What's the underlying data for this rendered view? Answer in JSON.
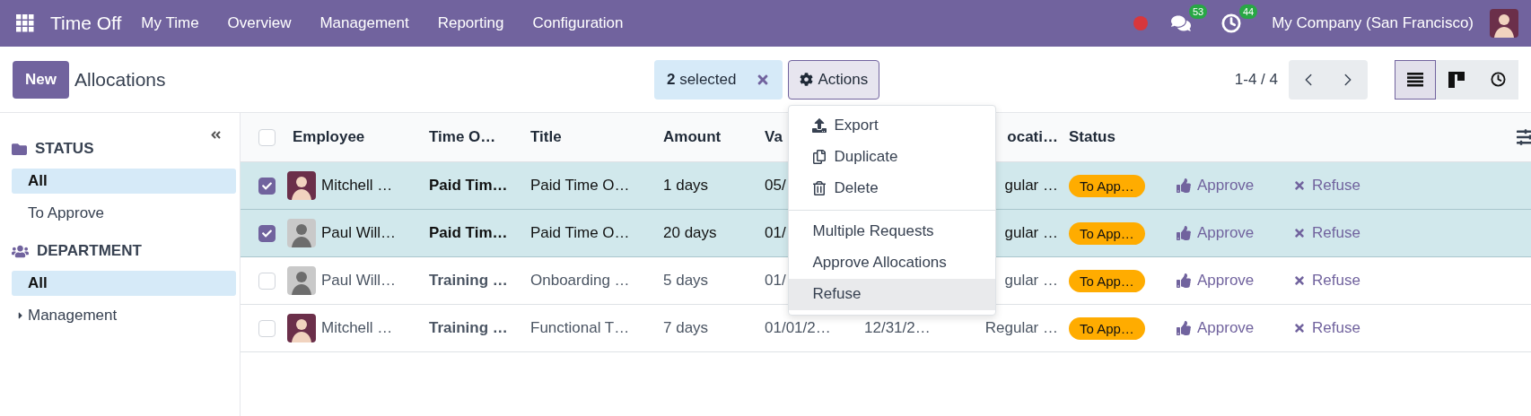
{
  "navbar": {
    "app_title": "Time Off",
    "menu": [
      "My Time",
      "Overview",
      "Management",
      "Reporting",
      "Configuration"
    ],
    "messages_count": "53",
    "activities_count": "44",
    "company": "My Company (San Francisco)"
  },
  "control_panel": {
    "new_button": "New",
    "breadcrumb": "Allocations",
    "selection": "**2** selected",
    "actions_button": "Actions",
    "pager": "1-4 / 4",
    "views": [
      {
        "kind": "list",
        "selected": true
      },
      {
        "kind": "kanban",
        "selected": false
      },
      {
        "kind": "activity",
        "selected": false
      }
    ]
  },
  "actions_menu": {
    "groups": [
      [
        {
          "label": "Export",
          "kind": "export",
          "highlighted": false
        },
        {
          "label": "Duplicate",
          "kind": "duplicate",
          "highlighted": false
        },
        {
          "label": "Delete",
          "kind": "delete",
          "highlighted": false
        }
      ],
      [
        {
          "label": "Multiple Requests",
          "kind": "plain",
          "highlighted": false
        },
        {
          "label": "Approve Allocations",
          "kind": "plain",
          "highlighted": false
        },
        {
          "label": "Refuse",
          "kind": "plain",
          "highlighted": true
        }
      ]
    ]
  },
  "sidebar": {
    "sections": [
      {
        "title": "STATUS",
        "kind": "folder",
        "items": [
          {
            "label": "All",
            "selected": true
          },
          {
            "label": "To Approve",
            "selected": false
          }
        ]
      },
      {
        "title": "DEPARTMENT",
        "kind": "users",
        "items": [
          {
            "label": "All",
            "selected": true
          },
          {
            "label": "Management",
            "selected": false,
            "expanded": false
          }
        ]
      }
    ]
  },
  "table": {
    "columns": {
      "employee": "Employee",
      "column_2": "Time O…",
      "title": "Title",
      "amount": "Amount",
      "column_5": "Va",
      "column_7": "ocati…",
      "status": "Status"
    },
    "all_checked": false,
    "rows": [
      {
        "selected": true,
        "kind": "cartoon",
        "employee": "Mitchell …",
        "column_2": "Paid Tim…",
        "title": "Paid Time O…",
        "amount": "1 days",
        "column_5": "05/",
        "column_7": "gular …",
        "status": "To App…",
        "approve": "Approve",
        "refuse": "Refuse"
      },
      {
        "selected": true,
        "kind": "photo",
        "employee": "Paul Will…",
        "column_2": "Paid Tim…",
        "title": "Paid Time O…",
        "amount": "20 days",
        "column_5": "01/",
        "column_7": "gular …",
        "status": "To App…",
        "approve": "Approve",
        "refuse": "Refuse"
      },
      {
        "selected": false,
        "kind": "photo",
        "employee": "Paul Will…",
        "column_2": "Training …",
        "title": "Onboarding …",
        "amount": "5 days",
        "column_5": "01/",
        "column_7": "gular …",
        "status": "To App…",
        "approve": "Approve",
        "refuse": "Refuse"
      },
      {
        "selected": false,
        "kind": "cartoon",
        "employee": "Mitchell …",
        "column_2": "Training …",
        "title": "Functional T…",
        "amount": "7 days",
        "column_5": "01/01/2…",
        "column_6": "12/31/2…",
        "column_7": "Regular …",
        "status": "To App…",
        "approve": "Approve",
        "refuse": "Refuse"
      }
    ]
  }
}
